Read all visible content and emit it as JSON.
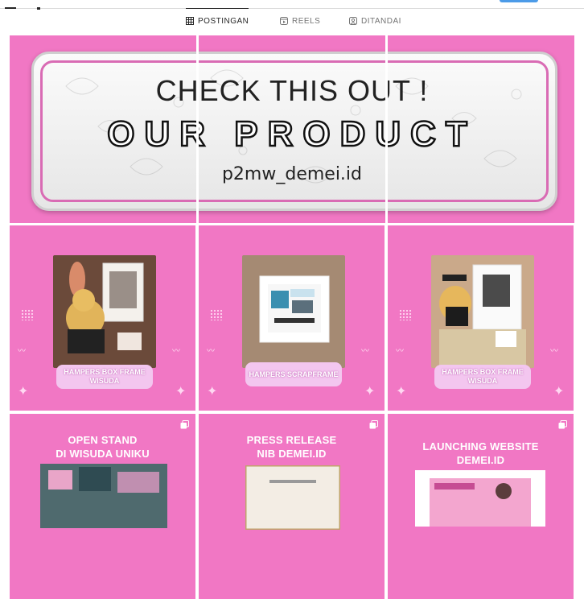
{
  "tabs": [
    {
      "label": "POSTINGAN",
      "icon": "grid-icon",
      "active": true
    },
    {
      "label": "REELS",
      "icon": "reels-icon",
      "active": false
    },
    {
      "label": "DITANDAI",
      "icon": "tagged-icon",
      "active": false
    }
  ],
  "banner": {
    "line1": "CHECK THIS OUT !",
    "line2": "OUR PRODUCT",
    "handle": "p2mw_demei.id"
  },
  "posts": [
    {
      "label": "HAMPERS BOX FRAME WISUDA"
    },
    {
      "label": "HAMPERS SCRAPFRAME"
    },
    {
      "label": "HAMPERS BOX FRAME WISUDA"
    },
    {
      "title": "OPEN STAND\nDI WISUDA UNIKU"
    },
    {
      "title": "PRESS RELEASE\nNIB DEMEI.ID"
    },
    {
      "title": "LAUNCHING WEBSITE\nDEMEI.ID"
    }
  ],
  "colors": {
    "tile_pink": "#f177c4",
    "pill": "#f3c6ef",
    "accent_blue": "#4c9be8"
  }
}
